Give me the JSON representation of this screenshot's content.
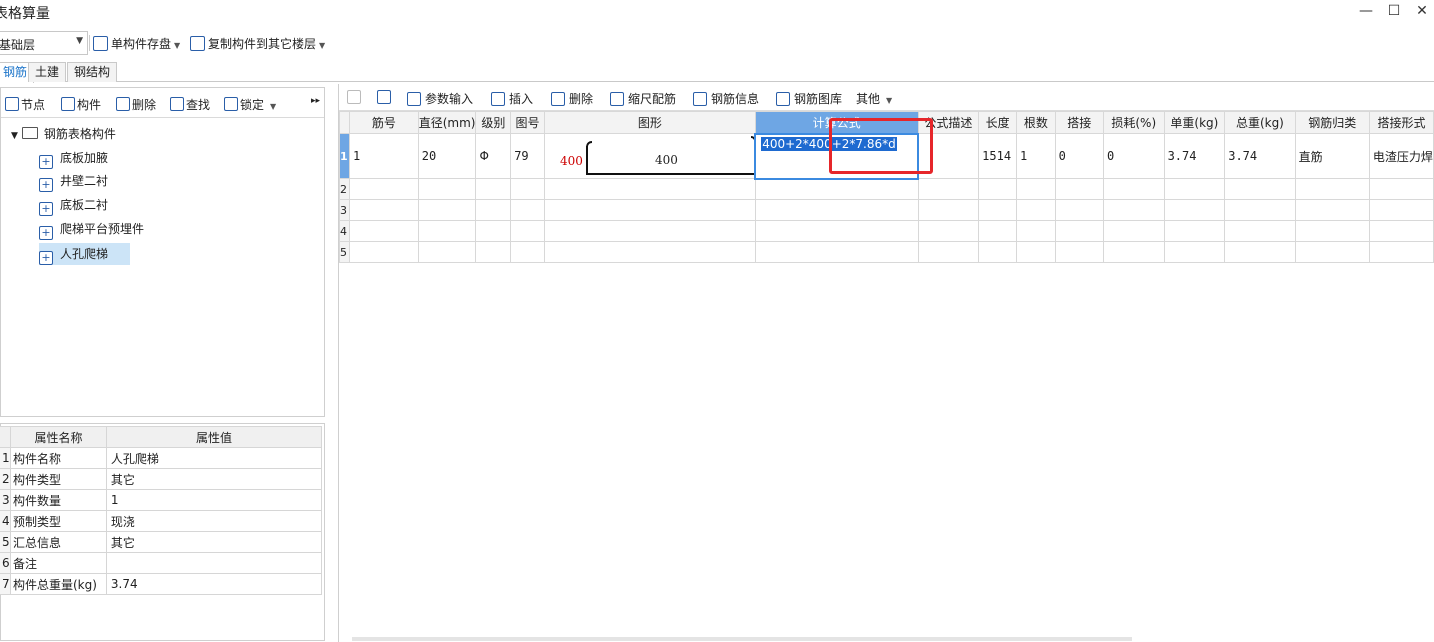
{
  "window": {
    "title": "表格算量",
    "controls": [
      "—",
      "☐",
      "✕"
    ]
  },
  "toolbar": {
    "floor": "基础层",
    "save_label": "单构件存盘",
    "copy_label": "复制构件到其它楼层"
  },
  "tabs": [
    "钢筋",
    "土建",
    "钢结构"
  ],
  "left_toolbar": {
    "node": "节点",
    "component": "构件",
    "delete": "删除",
    "find": "查找",
    "lock": "锁定"
  },
  "tree": {
    "root": "钢筋表格构件",
    "items": [
      "底板加腋",
      "井壁二衬",
      "底板二衬",
      "爬梯平台预埋件",
      "人孔爬梯"
    ],
    "selected_index": 4
  },
  "props": {
    "headers": [
      "属性名称",
      "属性值"
    ],
    "rows": [
      {
        "n": "1",
        "name": "构件名称",
        "value": "人孔爬梯"
      },
      {
        "n": "2",
        "name": "构件类型",
        "value": "其它"
      },
      {
        "n": "3",
        "name": "构件数量",
        "value": "1"
      },
      {
        "n": "4",
        "name": "预制类型",
        "value": "现浇"
      },
      {
        "n": "5",
        "name": "汇总信息",
        "value": "其它"
      },
      {
        "n": "6",
        "name": "备注",
        "value": ""
      },
      {
        "n": "7",
        "name": "构件总重量(kg)",
        "value": "3.74"
      }
    ]
  },
  "right_toolbar": {
    "param_input": "参数输入",
    "insert": "插入",
    "delete": "删除",
    "scale": "缩尺配筋",
    "rebar_info": "钢筋信息",
    "rebar_lib": "钢筋图库",
    "other": "其他"
  },
  "grid": {
    "headers": [
      "筋号",
      "直径(mm)",
      "级别",
      "图号",
      "图形",
      "计算公式",
      "公式描述",
      "长度",
      "根数",
      "搭接",
      "损耗(%)",
      "单重(kg)",
      "总重(kg)",
      "钢筋归类",
      "搭接形式"
    ],
    "row1": {
      "rn": "1",
      "no": "1",
      "dia": "20",
      "grade": "Φ",
      "fig": "79",
      "shape_left": "400",
      "shape_mid": "400",
      "formula": "400+2*400+2*7.86*d",
      "desc": "",
      "length": "1514",
      "count": "1",
      "lap": "0",
      "loss": "0",
      "unit_w": "3.74",
      "total_w": "3.74",
      "category": "直筋",
      "lap_type": "电渣压力焊"
    },
    "empty_rows": [
      "2",
      "3",
      "4",
      "5"
    ]
  }
}
